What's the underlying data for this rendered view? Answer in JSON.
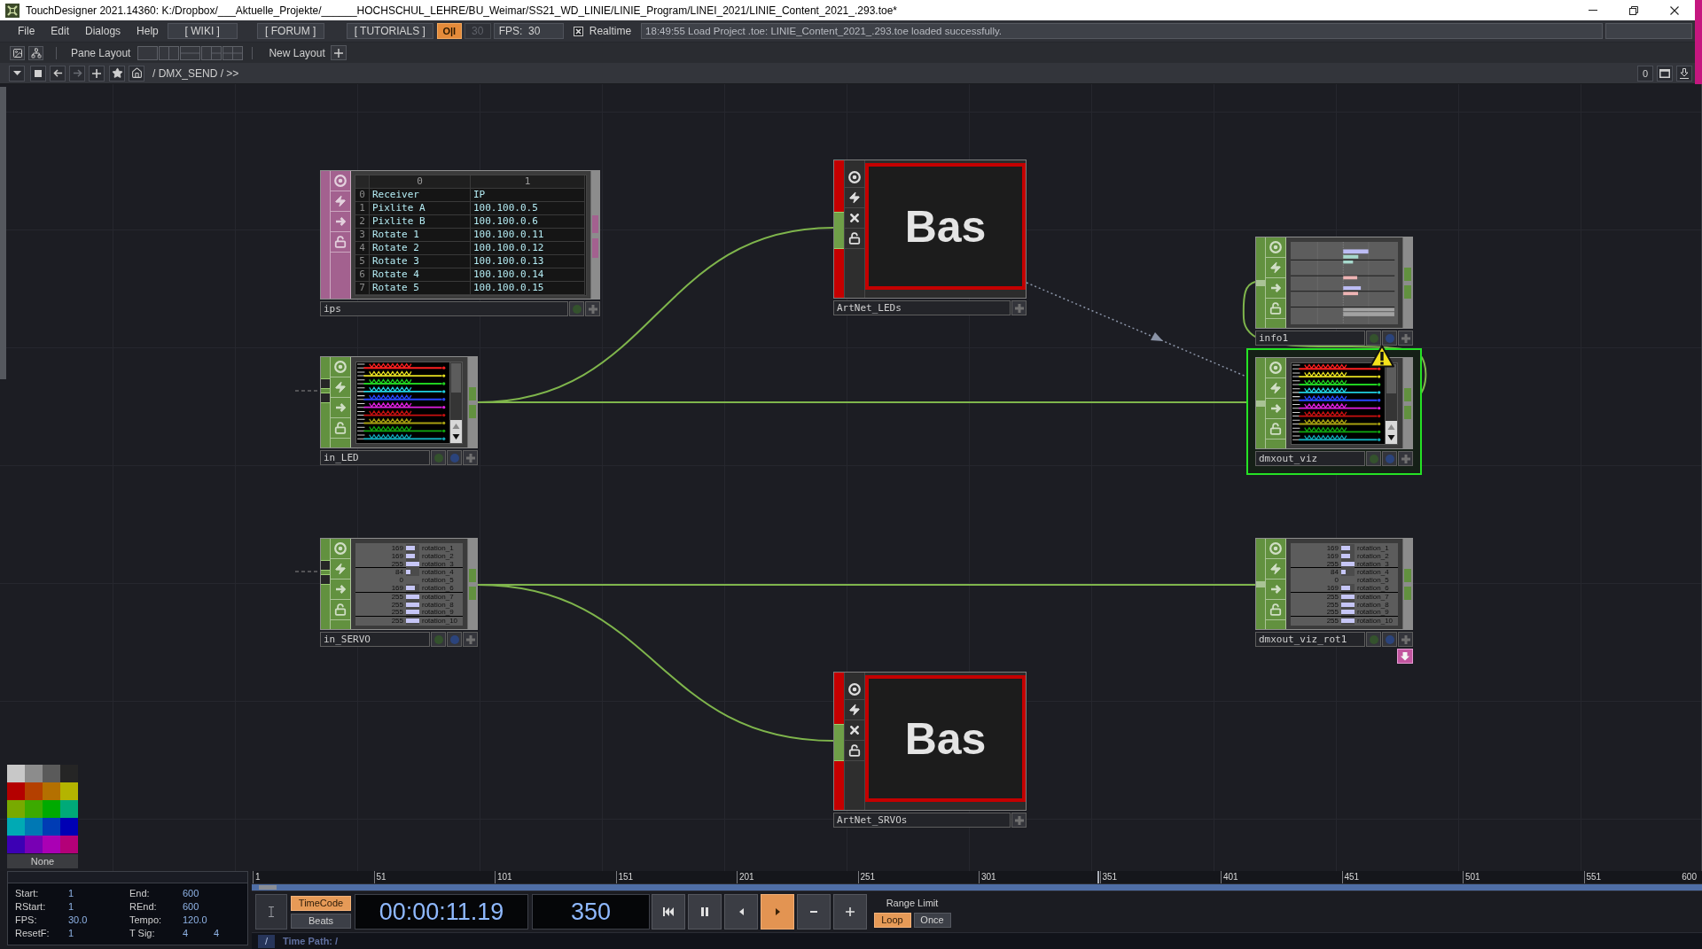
{
  "window": {
    "title": "TouchDesigner 2021.14360: K:/Dropbox/___Aktuelle_Projekte/______HOCHSCHUL_LEHRE/BU_Weimar/SS21_WD_LINIE/LINIE_Program/LINEI_2021/LINIE_Content_2021_.293.toe*"
  },
  "menu": [
    {
      "label": "File"
    },
    {
      "label": "Edit"
    },
    {
      "label": "Dialogs"
    },
    {
      "label": "Help"
    }
  ],
  "links": [
    {
      "label": "[ WIKI ]"
    },
    {
      "label": "[ FORUM ]"
    },
    {
      "label": "[ TUTORIALS ]"
    }
  ],
  "power": {
    "label": "O|I",
    "on": true
  },
  "fps_limit": "30",
  "fps": "FPS:  30",
  "realtime": {
    "label": "Realtime",
    "checked": true
  },
  "status": "18:49:55 Load Project .toe: LINIE_Content_2021_.293.toe loaded successfully.",
  "pane_bar": {
    "label": "Pane Layout",
    "new_layout": "New Layout"
  },
  "path_bar": {
    "path": "/ DMX_SEND / >>",
    "counter": "0"
  },
  "nodes": [
    {
      "name": "ips",
      "kind": "table",
      "color": "#a3618f",
      "selected": false,
      "table": {
        "columns": [
          "0",
          "1"
        ],
        "rows": [
          {
            "index": "0",
            "cells": [
              "Receiver",
              "IP"
            ]
          },
          {
            "index": "1",
            "cells": [
              "Pixlite A",
              "100.100.0.5"
            ]
          },
          {
            "index": "2",
            "cells": [
              "Pixlite B",
              "100.100.0.6"
            ]
          },
          {
            "index": "3",
            "cells": [
              "Rotate 1",
              "100.100.0.11"
            ]
          },
          {
            "index": "4",
            "cells": [
              "Rotate 2",
              "100.100.0.12"
            ]
          },
          {
            "index": "5",
            "cells": [
              "Rotate 3",
              "100.100.0.13"
            ]
          },
          {
            "index": "6",
            "cells": [
              "Rotate 4",
              "100.100.0.14"
            ]
          },
          {
            "index": "7",
            "cells": [
              "Rotate 5",
              "100.100.0.15"
            ]
          }
        ]
      }
    },
    {
      "name": "ArtNet_LEDs",
      "kind": "text",
      "color": "#c40000",
      "selected": false,
      "text": "Bas"
    },
    {
      "name": "info1",
      "kind": "bars",
      "color": "#62913f",
      "selected": false
    },
    {
      "name": "in_LED",
      "kind": "plot",
      "color": "#62913f",
      "selected": false
    },
    {
      "name": "dmxout_viz",
      "kind": "plot",
      "color": "#62913f",
      "selected": true,
      "warning": true
    },
    {
      "name": "in_SERVO",
      "kind": "list",
      "color": "#62913f",
      "selected": false,
      "channels": [
        {
          "value": "169",
          "name": "rotation_1",
          "level": 0.663
        },
        {
          "value": "169",
          "name": "rotation_2",
          "level": 0.663
        },
        {
          "value": "255",
          "name": "rotation_3",
          "level": 1
        },
        {
          "value": "84",
          "name": "rotation_4",
          "level": 0.329
        },
        {
          "value": "0",
          "name": "rotation_5"
        },
        {
          "value": "169",
          "name": "rotation_6",
          "level": 0.663
        },
        {
          "value": "255",
          "name": "rotation_7",
          "level": 1
        },
        {
          "value": "255",
          "name": "rotation_8",
          "level": 1
        },
        {
          "value": "255",
          "name": "rotation_9",
          "level": 1
        },
        {
          "value": "255",
          "name": "rotation_10",
          "level": 1
        }
      ]
    },
    {
      "name": "dmxout_viz_rot1",
      "kind": "list",
      "color": "#62913f",
      "selected": false,
      "docked": true,
      "channels": [
        {
          "value": "169",
          "name": "rotation_1",
          "level": 0.663
        },
        {
          "value": "169",
          "name": "rotation_2",
          "level": 0.663
        },
        {
          "value": "255",
          "name": "rotation_3",
          "level": 1
        },
        {
          "value": "84",
          "name": "rotation_4",
          "level": 0.329
        },
        {
          "value": "0",
          "name": "rotation_5"
        },
        {
          "value": "169",
          "name": "rotation_6",
          "level": 0.663
        },
        {
          "value": "255",
          "name": "rotation_7",
          "level": 1
        },
        {
          "value": "255",
          "name": "rotation_8",
          "level": 1
        },
        {
          "value": "255",
          "name": "rotation_9",
          "level": 1
        },
        {
          "value": "255",
          "name": "rotation_10",
          "level": 1
        }
      ]
    },
    {
      "name": "ArtNet_SRVOs",
      "kind": "text",
      "color": "#c40000",
      "selected": false,
      "text": "Bas"
    }
  ],
  "palette": {
    "swatches": [
      {
        "color": "#c8c8c8"
      },
      {
        "color": "#8c8c8c"
      },
      {
        "color": "#5a5a5a"
      },
      {
        "color": "#252525"
      },
      {
        "color": "#b40000"
      },
      {
        "color": "#b44000"
      },
      {
        "color": "#b47000"
      },
      {
        "color": "#b4b400"
      },
      {
        "color": "#78aa00"
      },
      {
        "color": "#3caa00"
      },
      {
        "color": "#00aa00"
      },
      {
        "color": "#00aa78"
      },
      {
        "color": "#00aab4"
      },
      {
        "color": "#0078b4"
      },
      {
        "color": "#003cb4"
      },
      {
        "color": "#0000b4"
      },
      {
        "color": "#3c00b4"
      },
      {
        "color": "#7800b4"
      },
      {
        "color": "#aa00b4"
      },
      {
        "color": "#b40078"
      }
    ],
    "none": "None"
  },
  "range_info": [
    {
      "label": "Start:",
      "values": [
        "1"
      ]
    },
    {
      "label": "End:",
      "values": [
        "600"
      ]
    },
    {
      "label": "RStart:",
      "values": [
        "1"
      ]
    },
    {
      "label": "REnd:",
      "values": [
        "600"
      ]
    },
    {
      "label": "FPS:",
      "values": [
        "30.0"
      ]
    },
    {
      "label": "Tempo:",
      "values": [
        "120.0"
      ]
    },
    {
      "label": "ResetF:",
      "values": [
        "1"
      ]
    },
    {
      "label": "T Sig:",
      "values": [
        "4",
        "4"
      ]
    }
  ],
  "timeline": {
    "ticks": [
      "1",
      "51",
      "101",
      "151",
      "201",
      "251",
      "301",
      "351",
      "401",
      "451",
      "501",
      "551",
      "600"
    ],
    "playhead": {
      "level": 0.583
    }
  },
  "transport": {
    "time_modes": [
      {
        "label": "TimeCode",
        "selected": true
      },
      {
        "label": "Beats",
        "selected": false
      }
    ],
    "timecode": "00:00:11.19",
    "frame": "350",
    "controls": [
      {
        "kind": "reset",
        "selected": false
      },
      {
        "kind": "pause",
        "selected": false
      },
      {
        "kind": "reverse",
        "selected": false
      },
      {
        "kind": "play",
        "selected": true
      },
      {
        "kind": "step-back",
        "selected": false
      },
      {
        "kind": "step-forward",
        "selected": false
      }
    ],
    "range_limit": {
      "label": "Range Limit",
      "options": [
        {
          "label": "Loop",
          "selected": true
        },
        {
          "label": "Once",
          "selected": false
        }
      ]
    }
  },
  "time_path": {
    "button": "/",
    "label": "Time Path: /"
  }
}
